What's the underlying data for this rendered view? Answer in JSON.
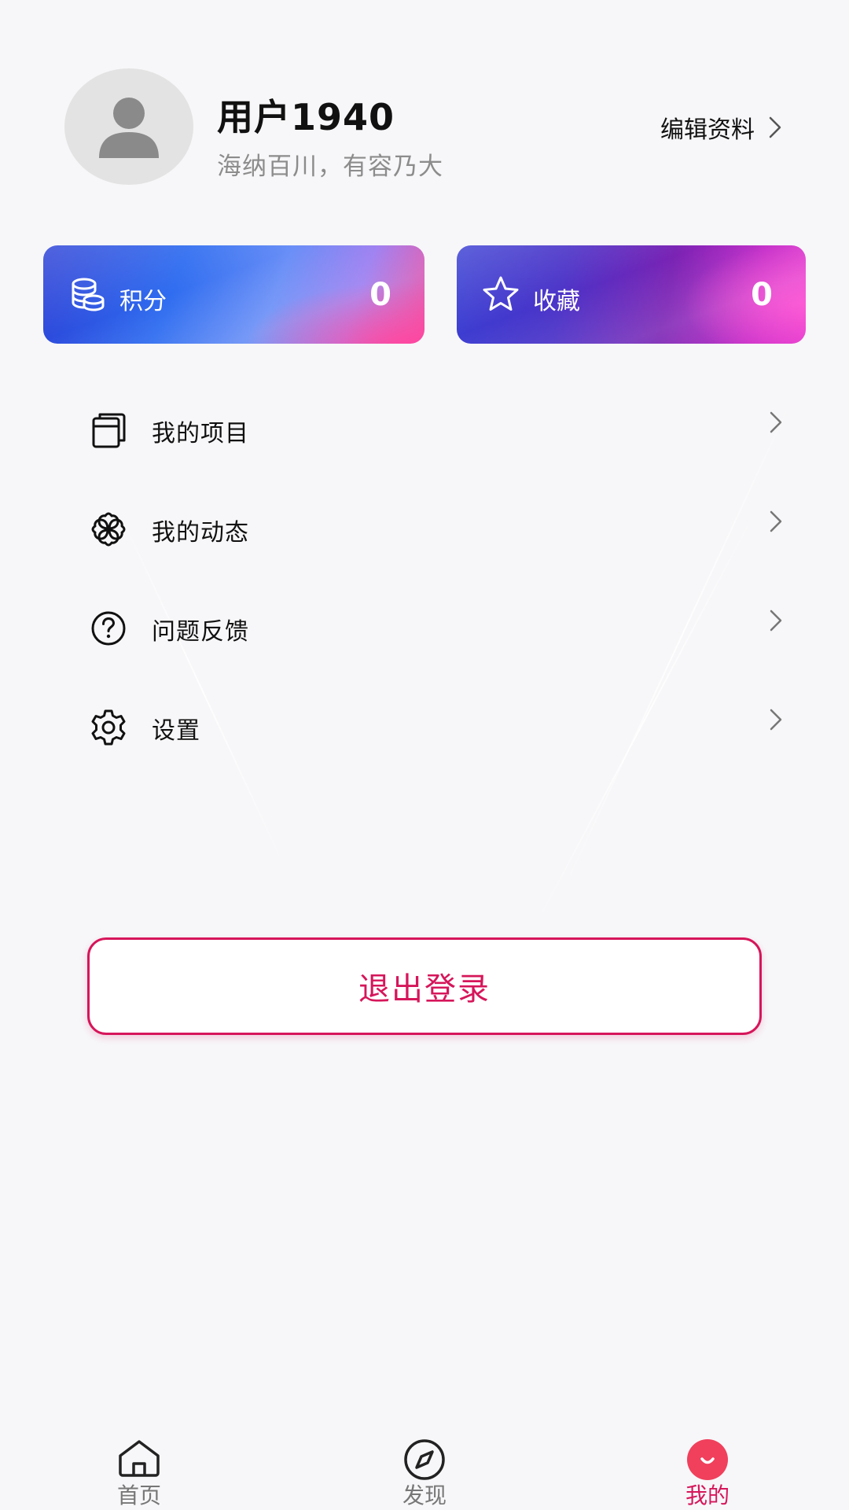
{
  "profile": {
    "username": "用户1940",
    "bio": "海纳百川，有容乃大",
    "edit_label": "编辑资料"
  },
  "stats": {
    "points": {
      "label": "积分",
      "value": "0",
      "icon": "coins-icon"
    },
    "favorites": {
      "label": "收藏",
      "value": "0",
      "icon": "star-icon"
    }
  },
  "menu": [
    {
      "label": "我的项目",
      "icon": "notebook-icon"
    },
    {
      "label": "我的动态",
      "icon": "clover-icon"
    },
    {
      "label": "问题反馈",
      "icon": "question-circle-icon"
    },
    {
      "label": "设置",
      "icon": "gear-icon"
    }
  ],
  "logout_label": "退出登录",
  "tabs": [
    {
      "label": "首页",
      "icon": "home-icon",
      "active": false
    },
    {
      "label": "发现",
      "icon": "compass-icon",
      "active": false
    },
    {
      "label": "我的",
      "icon": "smile-icon",
      "active": true
    }
  ],
  "colors": {
    "accent": "#d6165a",
    "background": "#f7f7f9",
    "muted_text": "#8c8c8c"
  }
}
